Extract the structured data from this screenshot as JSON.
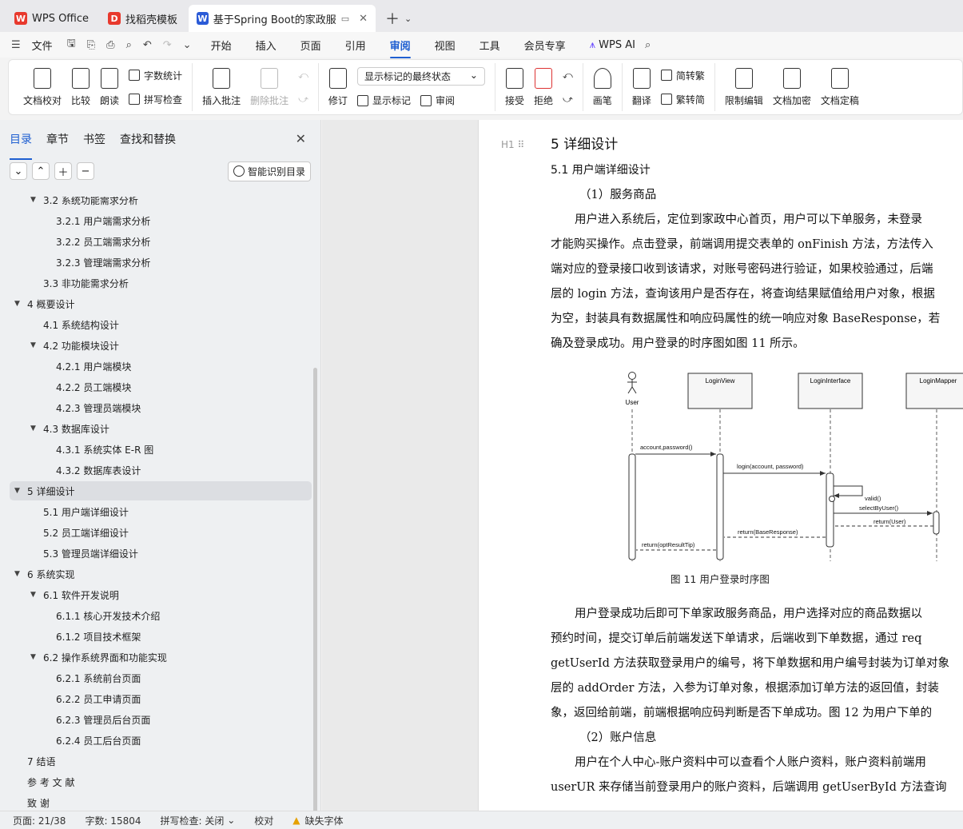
{
  "tabs": [
    {
      "label": "WPS Office",
      "icon": "wps-logo-icon",
      "color": "#e8392d"
    },
    {
      "label": "找稻壳模板",
      "icon": "docer-icon",
      "color": "#e8392d"
    },
    {
      "label": "基于Spring Boot的家政服务",
      "icon": "word-doc-icon",
      "color": "#2b5bd7",
      "active": true
    }
  ],
  "menu": {
    "file": "文件",
    "items": [
      "开始",
      "插入",
      "页面",
      "引用",
      "审阅",
      "视图",
      "工具",
      "会员专享"
    ],
    "active": "审阅",
    "ai": "WPS AI"
  },
  "ribbon": {
    "proofread": "文档校对",
    "compare": "比较",
    "read_aloud": "朗读",
    "word_count": "字数统计",
    "spell_check": "拼写检查",
    "insert_comment": "插入批注",
    "delete_comment": "删除批注",
    "revise": "修订",
    "markup_mode": "显示标记的最终状态",
    "show_markup": "显示标记",
    "review": "审阅",
    "accept": "接受",
    "reject": "拒绝",
    "ink": "画笔",
    "translate": "翻译",
    "to_traditional": "简转繁",
    "to_simplified": "繁转简",
    "restrict_edit": "限制编辑",
    "encrypt": "文档加密",
    "finalize": "文档定稿"
  },
  "leftpanel": {
    "tabs": [
      "目录",
      "章节",
      "书签",
      "查找和替换"
    ],
    "smart_toc": "智能识别目录",
    "toc": [
      {
        "text": "3.2   系统功能需求分析",
        "level": 2,
        "caret": "open"
      },
      {
        "text": "3.2.1   用户端需求分析",
        "level": 3
      },
      {
        "text": "3.2.2   员工端需求分析",
        "level": 3
      },
      {
        "text": "3.2.3   管理端需求分析",
        "level": 3
      },
      {
        "text": "3.3   非功能需求分析",
        "level": 2
      },
      {
        "text": "4   概要设计",
        "level": 1,
        "caret": "open"
      },
      {
        "text": "4.1   系统结构设计",
        "level": 2
      },
      {
        "text": "4.2   功能模块设计",
        "level": 2,
        "caret": "open"
      },
      {
        "text": "4.2.1   用户端模块",
        "level": 3
      },
      {
        "text": "4.2.2   员工端模块",
        "level": 3
      },
      {
        "text": "4.2.3   管理员端模块",
        "level": 3
      },
      {
        "text": "4.3   数据库设计",
        "level": 2,
        "caret": "open"
      },
      {
        "text": "4.3.1   系统实体 E-R 图",
        "level": 3
      },
      {
        "text": "4.3.2   数据库表设计",
        "level": 3
      },
      {
        "text": "5   详细设计",
        "level": 1,
        "caret": "open",
        "selected": true
      },
      {
        "text": "5.1   用户端详细设计",
        "level": 2
      },
      {
        "text": "5.2   员工端详细设计",
        "level": 2
      },
      {
        "text": "5.3   管理员端详细设计",
        "level": 2
      },
      {
        "text": "6   系统实现",
        "level": 1,
        "caret": "open"
      },
      {
        "text": "6.1   软件开发说明",
        "level": 2,
        "caret": "open"
      },
      {
        "text": "6.1.1   核心开发技术介绍",
        "level": 3
      },
      {
        "text": "6.1.2   项目技术框架",
        "level": 3
      },
      {
        "text": "6.2   操作系统界面和功能实现",
        "level": 2,
        "caret": "open"
      },
      {
        "text": "6.2.1   系统前台页面",
        "level": 3
      },
      {
        "text": "6.2.2   员工申请页面",
        "level": 3
      },
      {
        "text": "6.2.3   管理员后台页面",
        "level": 3
      },
      {
        "text": "6.2.4   员工后台页面",
        "level": 3
      },
      {
        "text": "7   结语",
        "level": 1
      },
      {
        "text": "参  考  文  献",
        "level": 1
      },
      {
        "text": "致          谢",
        "level": 1
      }
    ]
  },
  "document": {
    "heading_marker": "H1",
    "h1": "5   详细设计",
    "h2": "5.1   用户端详细设计",
    "lines": [
      {
        "text": "（1）服务商品",
        "indent": 1
      },
      {
        "text": "用户进入系统后，定位到家政中心首页，用户可以下单服务，未登录",
        "indent": 2
      },
      {
        "text": "才能购买操作。点击登录，前端调用提交表单的 onFinish 方法，方法传入",
        "indent": 0
      },
      {
        "text": "端对应的登录接口收到该请求，对账号密码进行验证，如果校验通过，后端",
        "indent": 0
      },
      {
        "text": "层的 login 方法，查询该用户是否存在，将查询结果赋值给用户对象，根据",
        "indent": 0
      },
      {
        "text": "为空，封装具有数据属性和响应码属性的统一响应对象 BaseResponse，若",
        "indent": 0
      },
      {
        "text": "确及登录成功。用户登录的时序图如图 11 所示。",
        "indent": 0
      }
    ],
    "lines2": [
      {
        "text": "用户登录成功后即可下单家政服务商品，用户选择对应的商品数据以",
        "indent": 2
      },
      {
        "text": "预约时间，提交订单后前端发送下单请求，后端收到下单数据，通过 req",
        "indent": 0
      },
      {
        "text": "getUserId 方法获取登录用户的编号，将下单数据和用户编号封装为订单对象",
        "indent": 0
      },
      {
        "text": "层的 addOrder 方法，入参为订单对象，根据添加订单方法的返回值，封装",
        "indent": 0
      },
      {
        "text": "象，返回给前端，前端根据响应码判断是否下单成功。图 12 为用户下单的",
        "indent": 0
      },
      {
        "text": "（2）账户信息",
        "indent": 1
      },
      {
        "text": "用户在个人中心-账户资料中可以查看个人账户资料，账户资料前端用",
        "indent": 2
      },
      {
        "text": "userUR 来存储当前登录用户的账户资料，后端调用 getUserById 方法查询",
        "indent": 0
      }
    ],
    "caption": "图 11  用户登录时序图"
  },
  "diagram": {
    "actor": "User",
    "lifelines": [
      "LoginView",
      "LoginInterface",
      "LoginMapper"
    ],
    "messages": [
      "account,password()",
      "login(account, password)",
      "valid()",
      "selectByUser()",
      "return(User)",
      "return(BaseResponse)",
      "return(optResultTip)"
    ]
  },
  "status": {
    "page": "页面: 21/38",
    "words": "字数: 15804",
    "spell": "拼写检查: 关闭",
    "proof": "校对",
    "missing_font": "缺失字体"
  }
}
